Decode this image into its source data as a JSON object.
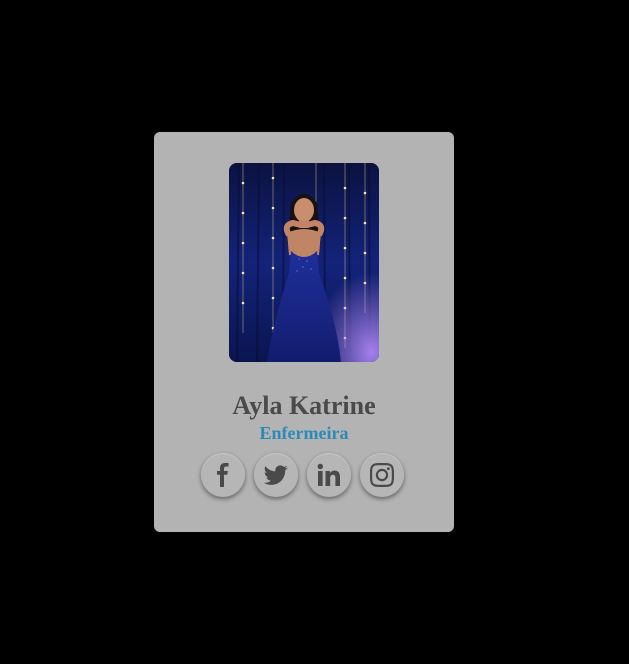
{
  "profile": {
    "name": "Ayla Katrine",
    "role": "Enfermeira"
  },
  "social": [
    {
      "icon": "facebook-icon"
    },
    {
      "icon": "twitter-icon"
    },
    {
      "icon": "linkedin-icon"
    },
    {
      "icon": "instagram-icon"
    }
  ],
  "colors": {
    "page_background": "#000000",
    "card_background": "#b3b3b3",
    "name_color": "#4a4a4a",
    "role_color": "#2b8ab8"
  }
}
